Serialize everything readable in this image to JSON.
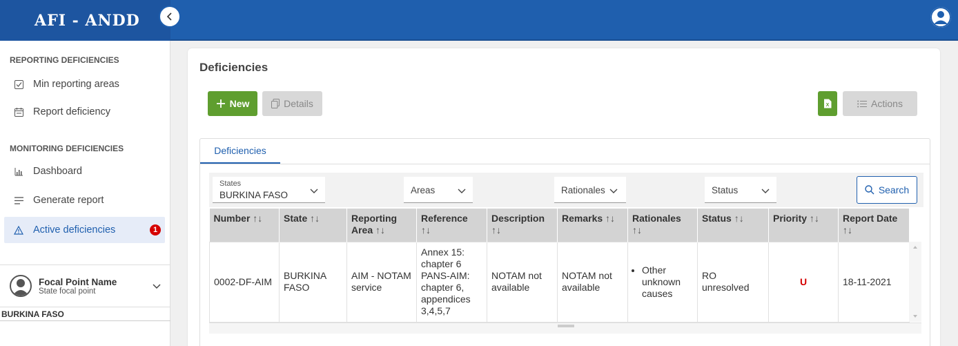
{
  "app": {
    "title": "AFI - ANDD"
  },
  "sidebar": {
    "section_reporting": "REPORTING DEFICIENCIES",
    "section_monitoring": "MONITORING DEFICIENCIES",
    "items": [
      {
        "label": "Min reporting areas",
        "icon": "checkbox-icon"
      },
      {
        "label": "Report deficiency",
        "icon": "calendar-icon"
      },
      {
        "label": "Dashboard",
        "icon": "bar-chart-icon"
      },
      {
        "label": "Generate report",
        "icon": "list-icon"
      },
      {
        "label": "Active deficiencies",
        "icon": "warning-icon",
        "badge": "1"
      }
    ],
    "user": {
      "name": "Focal Point Name",
      "role": "State focal point",
      "state": "BURKINA FASO"
    }
  },
  "page": {
    "title": "Deficiencies",
    "buttons": {
      "new": "New",
      "details": "Details",
      "actions": "Actions"
    },
    "tab": "Deficiencies"
  },
  "filters": {
    "states_label": "States",
    "states_value": "BURKINA FASO",
    "areas": "Areas",
    "rationales": "Rationales",
    "status": "Status",
    "search": "Search"
  },
  "table": {
    "sort_glyph": "↑↓",
    "headers": [
      "Number",
      "State",
      "Reporting Area",
      "Reference",
      "Description",
      "Remarks",
      "Rationales",
      "Status",
      "Priority",
      "Report Date"
    ],
    "rows": [
      {
        "number": "0002-DF-AIM",
        "state": "BURKINA FASO",
        "area": "AIM - NOTAM service",
        "reference": "Annex 15: chapter 6 PANS-AIM: chapter 6, appendices 3,4,5,7",
        "description": "NOTAM not available",
        "remarks": "NOTAM not available",
        "rationales": "Other unknown causes",
        "status": "RO unresolved",
        "priority": "U",
        "date": "18-11-2021"
      }
    ]
  },
  "colors": {
    "primary": "#1f5fae",
    "success": "#5f9e2f",
    "danger": "#d50000"
  }
}
